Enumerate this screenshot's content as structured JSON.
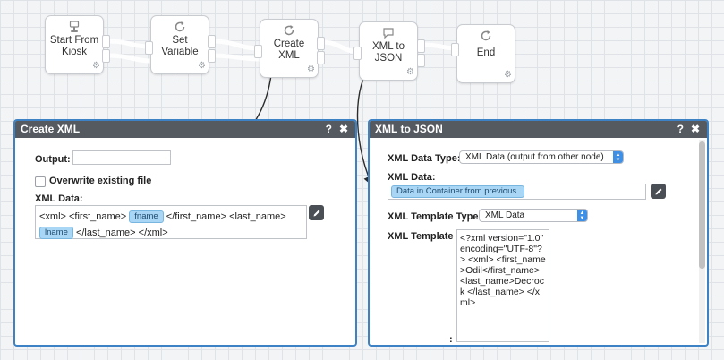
{
  "flow": {
    "nodes": [
      {
        "label": "Start From Kiosk",
        "icon": "kiosk-icon"
      },
      {
        "label": "Set Variable",
        "icon": "refresh-icon"
      },
      {
        "label": "Create XML",
        "icon": "refresh-icon"
      },
      {
        "label": "XML to JSON",
        "icon": "speech-bubble-icon"
      },
      {
        "label": "End",
        "icon": "refresh-icon"
      }
    ]
  },
  "create_xml": {
    "title": "Create XML",
    "help": "?",
    "close": "✖",
    "output_label": "Output:",
    "output_value": "",
    "overwrite_label": "Overwrite existing file",
    "xml_data_label": "XML Data:",
    "xml_data": {
      "t1": "<xml> <first_name>",
      "pill1": "fname",
      "t2": "</first_name> <last_name>",
      "pill2": "lname",
      "t3": "</last_name> </xml>"
    }
  },
  "xml_to_json": {
    "title": "XML to JSON",
    "help": "?",
    "close": "✖",
    "data_type_label": "XML Data Type:",
    "data_type_value": "XML Data (output from other node)",
    "xml_data_label": "XML Data:",
    "xml_data_pill": "Data in Container from previous.",
    "template_type_label": "XML Template Type:",
    "template_type_value": "XML Data",
    "template_label": "XML Template",
    "template_colon": ":",
    "template_value": "<?xml version=\"1.0\" encoding=\"UTF-8\"?> <xml> <first_name>Odil</first_name> <last_name>Decrock </last_name> </xml>"
  }
}
